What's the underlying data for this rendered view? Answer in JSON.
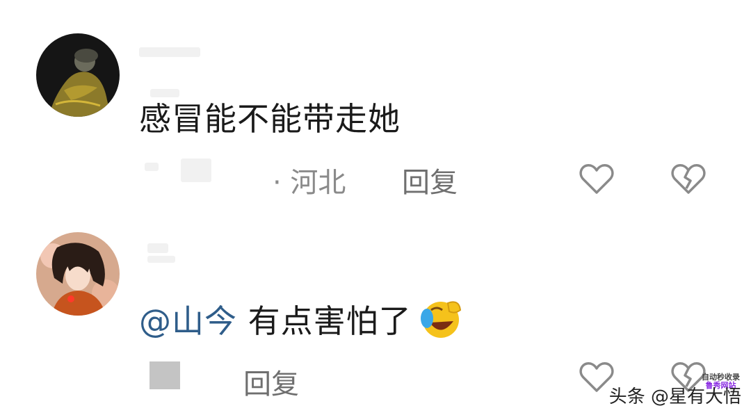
{
  "comments": [
    {
      "text": "感冒能不能带走她",
      "location": "· 河北",
      "reply_label": "回复"
    },
    {
      "mention": "@山今",
      "text": " 有点害怕了",
      "reply_label": "回复"
    }
  ],
  "icons": {
    "like": "heart-outline-icon",
    "dislike": "broken-heart-icon",
    "emoji": "laughing-crying-emoji"
  },
  "colors": {
    "mention": "#2f5d8a",
    "meta": "#8a8a8a",
    "icon": "#8a8a8a"
  },
  "watermark": {
    "text": "头条 @星有大悟",
    "stamp_line1": "自动秒收录",
    "stamp_line2": "鲁秀网站"
  }
}
